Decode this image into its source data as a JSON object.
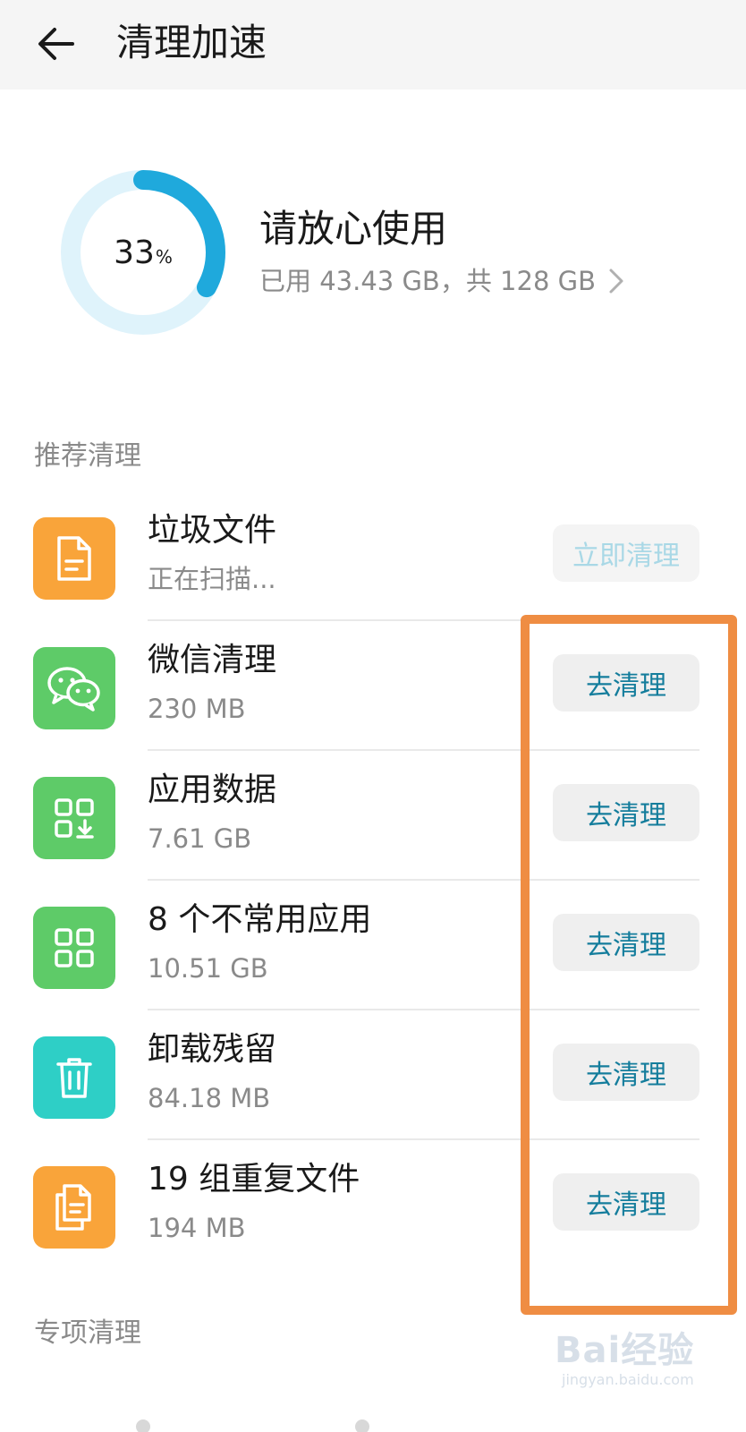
{
  "header": {
    "title": "清理加速"
  },
  "storage": {
    "percent_value": "33",
    "percent_sign": "%",
    "usage_fraction": 0.33,
    "status": "请放心使用",
    "detail": "已用 43.43 GB，共 128 GB"
  },
  "recommended": {
    "title": "推荐清理",
    "items": [
      {
        "name": "垃圾文件",
        "size": "正在扫描...",
        "action": "立即清理",
        "icon": "document-icon",
        "color": "#f9a43a"
      },
      {
        "name": "微信清理",
        "size": "230 MB",
        "action": "去清理",
        "icon": "wechat-icon",
        "color": "#5ecb68"
      },
      {
        "name": "应用数据",
        "size": "7.61 GB",
        "action": "去清理",
        "icon": "app-data-icon",
        "color": "#5ecb68"
      },
      {
        "name": "8 个不常用应用",
        "size": "10.51 GB",
        "action": "去清理",
        "icon": "apps-grid-icon",
        "color": "#5ecb68"
      },
      {
        "name": "卸载残留",
        "size": "84.18 MB",
        "action": "去清理",
        "icon": "trash-icon",
        "color": "#2ecfc6"
      },
      {
        "name": "19 组重复文件",
        "size": "194 MB",
        "action": "去清理",
        "icon": "duplicate-files-icon",
        "color": "#f9a43a"
      }
    ]
  },
  "special": {
    "title": "专项清理"
  },
  "watermark": {
    "logo": "Bai经验",
    "url": "jingyan.baidu.com"
  },
  "colors": {
    "accent": "#1fa9dc",
    "ring_track": "#dff3fb",
    "button_text": "#147d9c",
    "highlight": "#ef8d43"
  }
}
